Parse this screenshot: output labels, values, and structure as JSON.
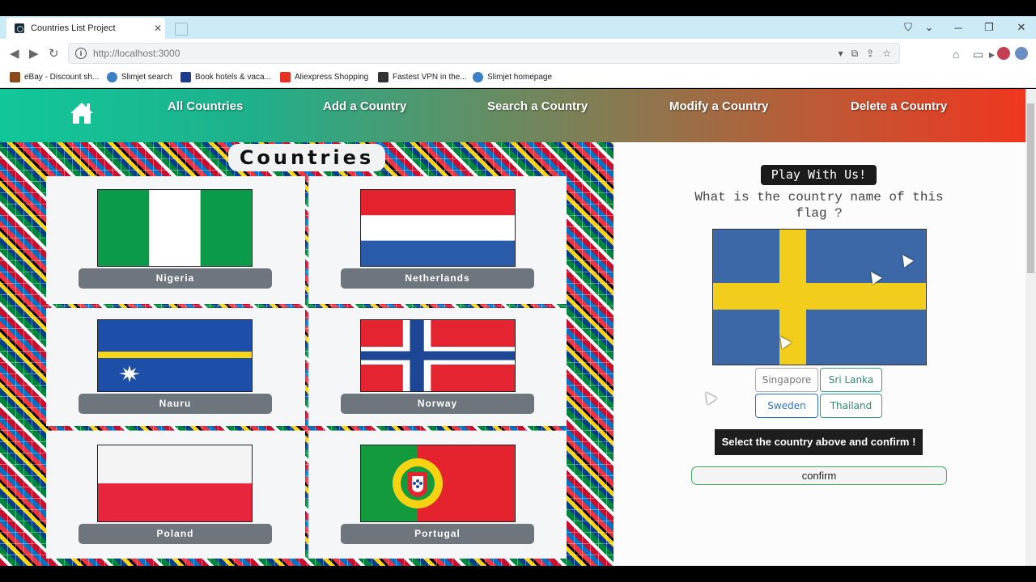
{
  "browser": {
    "tab_title": "Countries List Project",
    "url": "http://localhost:3000",
    "bookmarks": [
      {
        "label": "eBay - Discount sh...",
        "color": "#8b4a1c"
      },
      {
        "label": "Slimjet search",
        "color": "#3d7fc4"
      },
      {
        "label": "Book hotels & vaca...",
        "color": "#1d3c8f"
      },
      {
        "label": "Aliexpress Shopping",
        "color": "#e43225"
      },
      {
        "label": "Fastest VPN in the...",
        "color": "#333333"
      },
      {
        "label": "Slimjet homepage",
        "color": "#3d7fc4"
      }
    ]
  },
  "nav": {
    "home_icon": "home-icon",
    "links": [
      "All Countries",
      "Add a Country",
      "Search a Country",
      "Modify a Country",
      "Delete a Country"
    ]
  },
  "main": {
    "title": "Countries",
    "countries": [
      "Nigeria",
      "Netherlands",
      "Nauru",
      "Norway",
      "Poland",
      "Portugal"
    ]
  },
  "quiz": {
    "badge": "Play With Us!",
    "question": "What is the country name of this flag ?",
    "options": [
      "Singapore",
      "Sri Lanka",
      "Sweden",
      "Thailand"
    ],
    "hint": "Select the country above and confirm !",
    "confirm_label": "confirm"
  },
  "colors": {
    "nav_start": "#11c79a",
    "nav_end": "#f0361f",
    "country_button": "#6e757c",
    "confirm_border": "#3cae59"
  }
}
